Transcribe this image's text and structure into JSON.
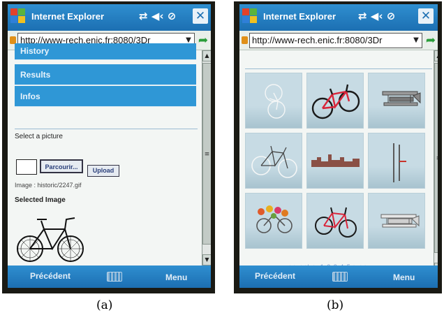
{
  "captions": {
    "a": "(a)",
    "b": "(b)"
  },
  "colors": {
    "titlebar": "#1c6fb2",
    "nav_button": "#2f97d6",
    "go_arrow": "#2a9d3a",
    "lock": "#e09018"
  },
  "screen_a": {
    "title": "Internet Explorer",
    "status_icons": "⇄ ◀‹ ⊘",
    "close": "✕",
    "address": "http://www-rech.enic.fr:8080/3Dr",
    "nav": [
      {
        "label": "History"
      },
      {
        "label": "Results"
      },
      {
        "label": "Infos"
      }
    ],
    "select_label": "Select a picture",
    "browse_button": "Parcourir...",
    "upload_button": "Upload",
    "image_path": "Image : historic/2247.gif",
    "selected_label": "Selected Image",
    "softkey_left": "Précédent",
    "softkey_right": "Menu"
  },
  "screen_b": {
    "title": "Internet Explorer",
    "status_icons": "⇄ ◀‹ ⊘",
    "close": "✕",
    "address": "http://www-rech.enic.fr:8080/3Dr",
    "tiles": [
      {
        "icon": "bicycle-wireframe-icon"
      },
      {
        "icon": "red-bicycle-icon"
      },
      {
        "icon": "biplane-icon"
      },
      {
        "icon": "bicycle-wireframe-icon"
      },
      {
        "icon": "city-skyline-icon"
      },
      {
        "icon": "pole-icon"
      },
      {
        "icon": "flowers-bicycle-icon"
      },
      {
        "icon": "red-bicycle-icon"
      },
      {
        "icon": "biplane-icon"
      }
    ],
    "pager": "<< <</n> 1 2 3 4 5 > >>",
    "softkey_left": "Précédent",
    "softkey_right": "Menu"
  }
}
